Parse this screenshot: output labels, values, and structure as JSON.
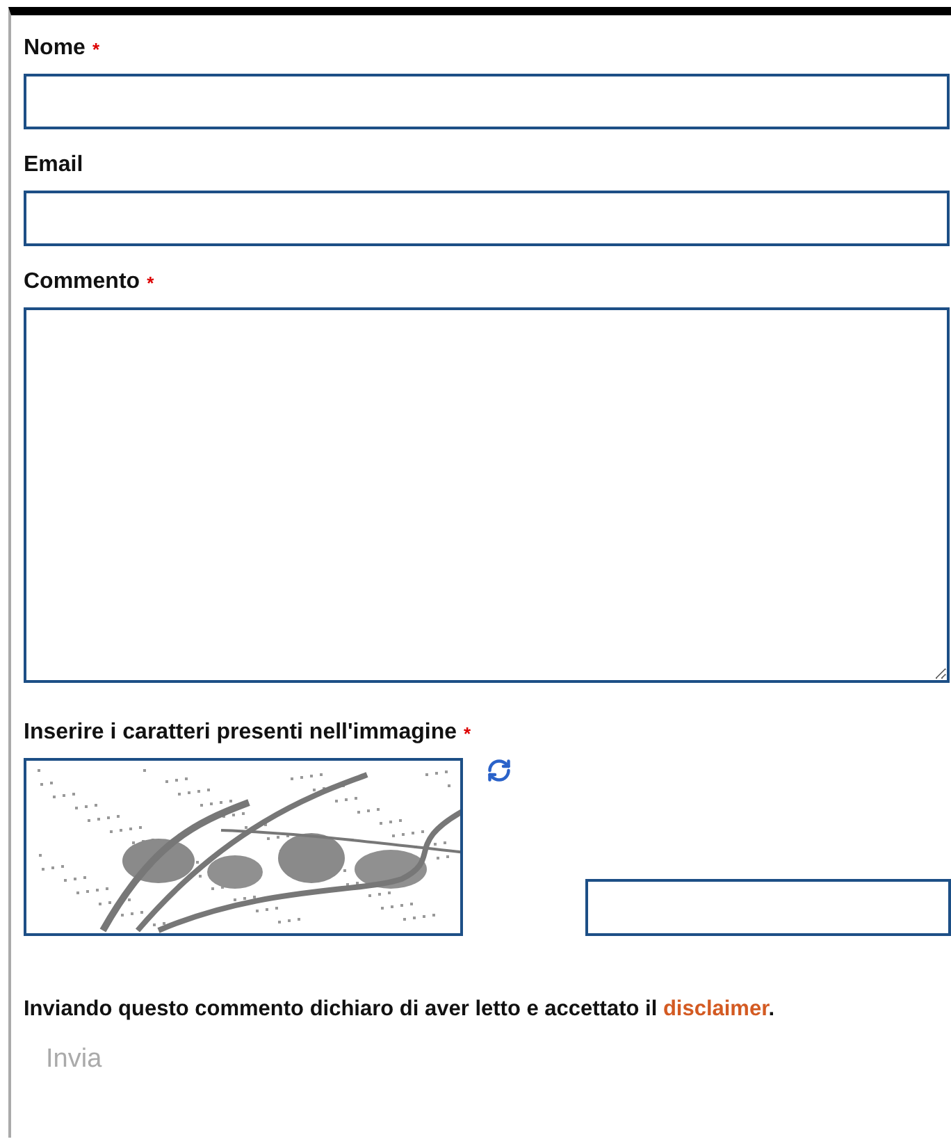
{
  "required_mark": "*",
  "fields": [
    {
      "kind": "input",
      "label": "Nome",
      "required": true
    },
    {
      "kind": "input",
      "label": "Email",
      "required": false
    },
    {
      "kind": "textarea",
      "label": "Commento",
      "required": true
    }
  ],
  "captcha": {
    "label": "Inserire i caratteri presenti nell'immagine",
    "required": true
  },
  "consent": {
    "text_before": "Inviando questo commento dichiaro di aver letto e accettato il ",
    "link": "disclaimer",
    "text_after": "."
  },
  "submit": {
    "label": "Invia",
    "disabled": true
  }
}
